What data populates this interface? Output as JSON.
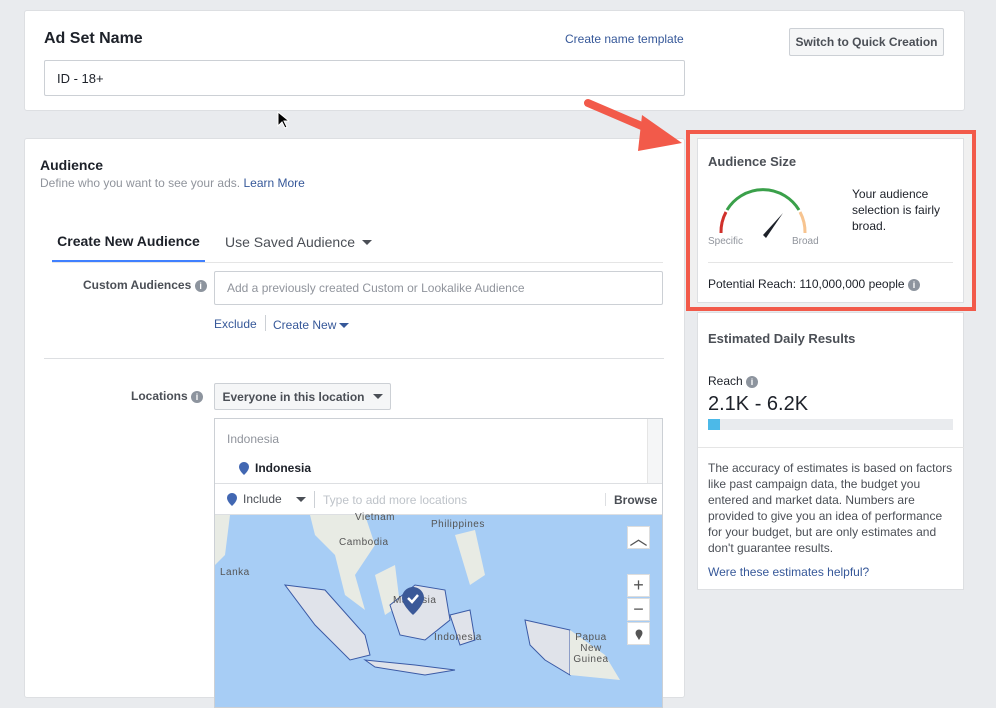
{
  "adset": {
    "title": "Ad Set Name",
    "template_link": "Create name template",
    "switch_button": "Switch to Quick Creation",
    "name_value": "ID - 18+"
  },
  "audience": {
    "title": "Audience",
    "subtitle": "Define who you want to see your ads.",
    "learn_more": "Learn More",
    "tabs": [
      {
        "label": "Create New Audience",
        "active": true
      },
      {
        "label": "Use Saved Audience",
        "active": false
      }
    ],
    "custom_label": "Custom Audiences",
    "custom_placeholder": "Add a previously created Custom or Lookalike Audience",
    "exclude": "Exclude",
    "create_new": "Create New",
    "locations_label": "Locations",
    "locations_select": "Everyone in this location",
    "location_group": "Indonesia",
    "location_item": "Indonesia",
    "include": "Include",
    "location_placeholder": "Type to add more locations",
    "browse": "Browse",
    "map_labels": [
      "Vietnam",
      "Philippines",
      "Cambodia",
      "Lanka",
      "Malaysia",
      "Indonesia",
      "Papua New Guinea"
    ]
  },
  "audience_size": {
    "title": "Audience Size",
    "specific": "Specific",
    "broad": "Broad",
    "message": "Your audience selection is fairly broad.",
    "potential_reach": "Potential Reach: 110,000,000 people"
  },
  "estimates": {
    "title": "Estimated Daily Results",
    "reach_label": "Reach",
    "reach_value": "2.1K - 6.2K",
    "reach_fill_percent": 5,
    "disclaimer": "The accuracy of estimates is based on factors like past campaign data, the budget you entered and market data. Numbers are provided to give you an idea of performance for your budget, but are only estimates and don't guarantee results.",
    "helpful_link": "Were these estimates helpful?"
  },
  "colors": {
    "highlight": "#f25a4a",
    "link": "#365899",
    "accent": "#4080ff",
    "map_water": "#a7cdf5"
  }
}
